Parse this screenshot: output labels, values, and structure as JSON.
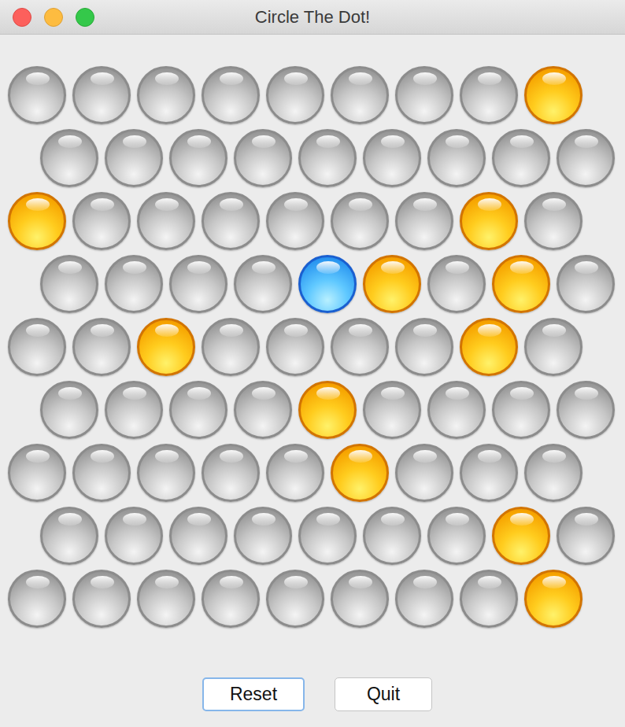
{
  "window": {
    "title": "Circle The Dot!"
  },
  "board": {
    "rows": [
      {
        "cells": [
          {
            "kind": "empty"
          },
          {
            "kind": "empty"
          },
          {
            "kind": "empty"
          },
          {
            "kind": "empty"
          },
          {
            "kind": "empty"
          },
          {
            "kind": "empty"
          },
          {
            "kind": "empty"
          },
          {
            "kind": "empty"
          },
          {
            "kind": "selected"
          }
        ]
      },
      {
        "cells": [
          {
            "kind": "empty"
          },
          {
            "kind": "empty"
          },
          {
            "kind": "empty"
          },
          {
            "kind": "empty"
          },
          {
            "kind": "empty"
          },
          {
            "kind": "empty"
          },
          {
            "kind": "empty"
          },
          {
            "kind": "empty"
          },
          {
            "kind": "empty"
          }
        ]
      },
      {
        "cells": [
          {
            "kind": "selected"
          },
          {
            "kind": "empty"
          },
          {
            "kind": "empty"
          },
          {
            "kind": "empty"
          },
          {
            "kind": "empty"
          },
          {
            "kind": "empty"
          },
          {
            "kind": "empty"
          },
          {
            "kind": "selected"
          },
          {
            "kind": "empty"
          }
        ]
      },
      {
        "cells": [
          {
            "kind": "empty"
          },
          {
            "kind": "empty"
          },
          {
            "kind": "empty"
          },
          {
            "kind": "empty"
          },
          {
            "kind": "dot"
          },
          {
            "kind": "selected"
          },
          {
            "kind": "empty"
          },
          {
            "kind": "selected"
          },
          {
            "kind": "empty"
          }
        ]
      },
      {
        "cells": [
          {
            "kind": "empty"
          },
          {
            "kind": "empty"
          },
          {
            "kind": "selected"
          },
          {
            "kind": "empty"
          },
          {
            "kind": "empty"
          },
          {
            "kind": "empty"
          },
          {
            "kind": "empty"
          },
          {
            "kind": "selected"
          },
          {
            "kind": "empty"
          }
        ]
      },
      {
        "cells": [
          {
            "kind": "empty"
          },
          {
            "kind": "empty"
          },
          {
            "kind": "empty"
          },
          {
            "kind": "empty"
          },
          {
            "kind": "selected"
          },
          {
            "kind": "empty"
          },
          {
            "kind": "empty"
          },
          {
            "kind": "empty"
          },
          {
            "kind": "empty"
          }
        ]
      },
      {
        "cells": [
          {
            "kind": "empty"
          },
          {
            "kind": "empty"
          },
          {
            "kind": "empty"
          },
          {
            "kind": "empty"
          },
          {
            "kind": "empty"
          },
          {
            "kind": "selected"
          },
          {
            "kind": "empty"
          },
          {
            "kind": "empty"
          },
          {
            "kind": "empty"
          }
        ]
      },
      {
        "cells": [
          {
            "kind": "empty"
          },
          {
            "kind": "empty"
          },
          {
            "kind": "empty"
          },
          {
            "kind": "empty"
          },
          {
            "kind": "empty"
          },
          {
            "kind": "empty"
          },
          {
            "kind": "empty"
          },
          {
            "kind": "selected"
          },
          {
            "kind": "empty"
          }
        ]
      },
      {
        "cells": [
          {
            "kind": "empty"
          },
          {
            "kind": "empty"
          },
          {
            "kind": "empty"
          },
          {
            "kind": "empty"
          },
          {
            "kind": "empty"
          },
          {
            "kind": "empty"
          },
          {
            "kind": "empty"
          },
          {
            "kind": "empty"
          },
          {
            "kind": "selected"
          }
        ]
      }
    ]
  },
  "buttons": [
    {
      "label": "Reset",
      "selected": true
    },
    {
      "label": "Quit",
      "selected": false
    }
  ]
}
